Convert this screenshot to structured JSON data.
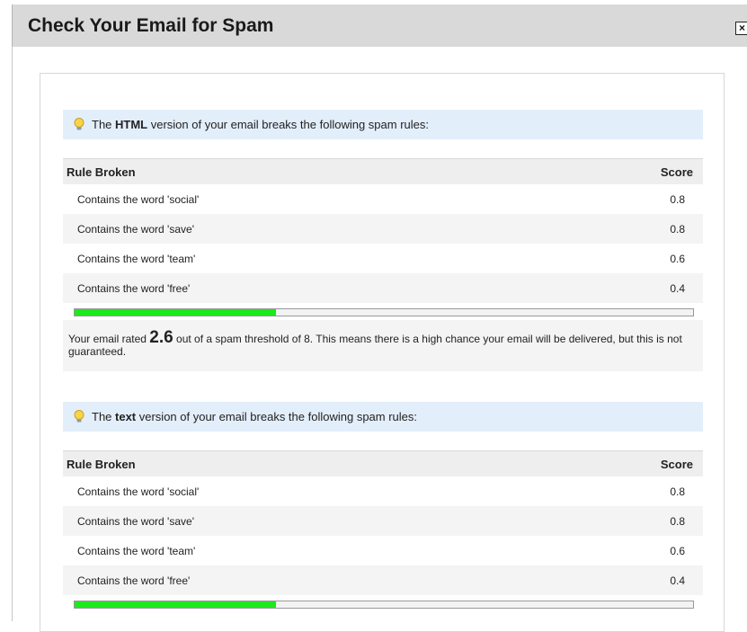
{
  "dialog": {
    "title": "Check Your Email for Spam",
    "close_glyph": "×"
  },
  "sections": [
    {
      "notice_prefix": "The ",
      "notice_bold": "HTML",
      "notice_suffix": " version of your email breaks the following spam rules:",
      "col_rule": "Rule Broken",
      "col_score": "Score",
      "rules": [
        {
          "rule": "Contains the word 'social'",
          "score": "0.8"
        },
        {
          "rule": "Contains the word 'save'",
          "score": "0.8"
        },
        {
          "rule": "Contains the word 'team'",
          "score": "0.6"
        },
        {
          "rule": "Contains the word 'free'",
          "score": "0.4"
        }
      ],
      "meter_fraction": 0.325,
      "summary_prefix": "Your email rated ",
      "summary_score": "2.6",
      "summary_suffix": " out of a spam threshold of 8. This means there is a high chance your email will be delivered, but this is not guaranteed."
    },
    {
      "notice_prefix": "The ",
      "notice_bold": "text",
      "notice_suffix": " version of your email breaks the following spam rules:",
      "col_rule": "Rule Broken",
      "col_score": "Score",
      "rules": [
        {
          "rule": "Contains the word 'social'",
          "score": "0.8"
        },
        {
          "rule": "Contains the word 'save'",
          "score": "0.8"
        },
        {
          "rule": "Contains the word 'team'",
          "score": "0.6"
        },
        {
          "rule": "Contains the word 'free'",
          "score": "0.4"
        }
      ],
      "meter_fraction": 0.325
    }
  ],
  "colors": {
    "meter_fill": "#1ee81e",
    "notice_bg": "#e3eefb",
    "titlebar_bg": "#d9d9d9"
  },
  "icons": {
    "notice_icon": "lightbulb-icon",
    "close_icon": "close-icon"
  }
}
